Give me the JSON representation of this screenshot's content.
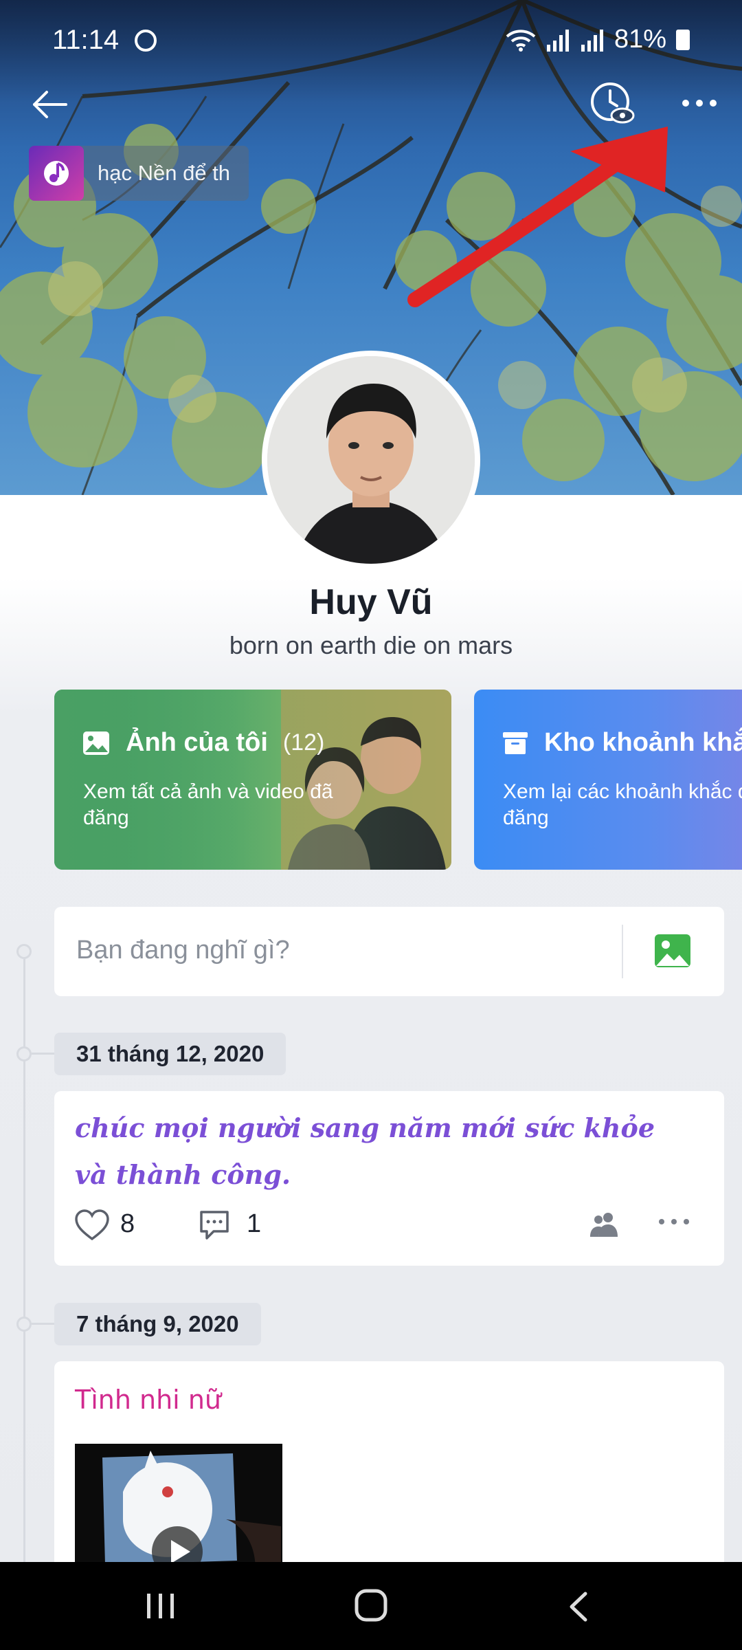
{
  "status_bar": {
    "time": "11:14",
    "battery": "81%"
  },
  "header": {
    "music_title": "hạc Nền để th"
  },
  "profile": {
    "name": "Huy Vũ",
    "bio": "born on earth die on mars"
  },
  "albums": [
    {
      "title": "Ảnh của tôi",
      "count": "(12)",
      "description": "Xem tất cả ảnh và video đã đăng",
      "icon": "image-icon"
    },
    {
      "title": "Kho khoảnh khắc",
      "description": "Xem lại các khoảnh khắc đã đăng",
      "icon": "archive-icon"
    }
  ],
  "composer": {
    "placeholder": "Bạn đang nghĩ gì?"
  },
  "posts": [
    {
      "date": "31 tháng 12, 2020",
      "text": "chúc mọi người sang năm mới sức khỏe và thành công.",
      "likes": "8",
      "comments": "1"
    },
    {
      "date": "7 tháng 9, 2020",
      "title": "Tình nhi nữ"
    }
  ],
  "colors": {
    "annotation_arrow": "#e02424",
    "post_fancy_text": "#7b4fd6",
    "post_title_pink": "#d12a8e",
    "photos_card_green": "#3f9b63",
    "moments_card_blue": "#3b8cf4"
  }
}
